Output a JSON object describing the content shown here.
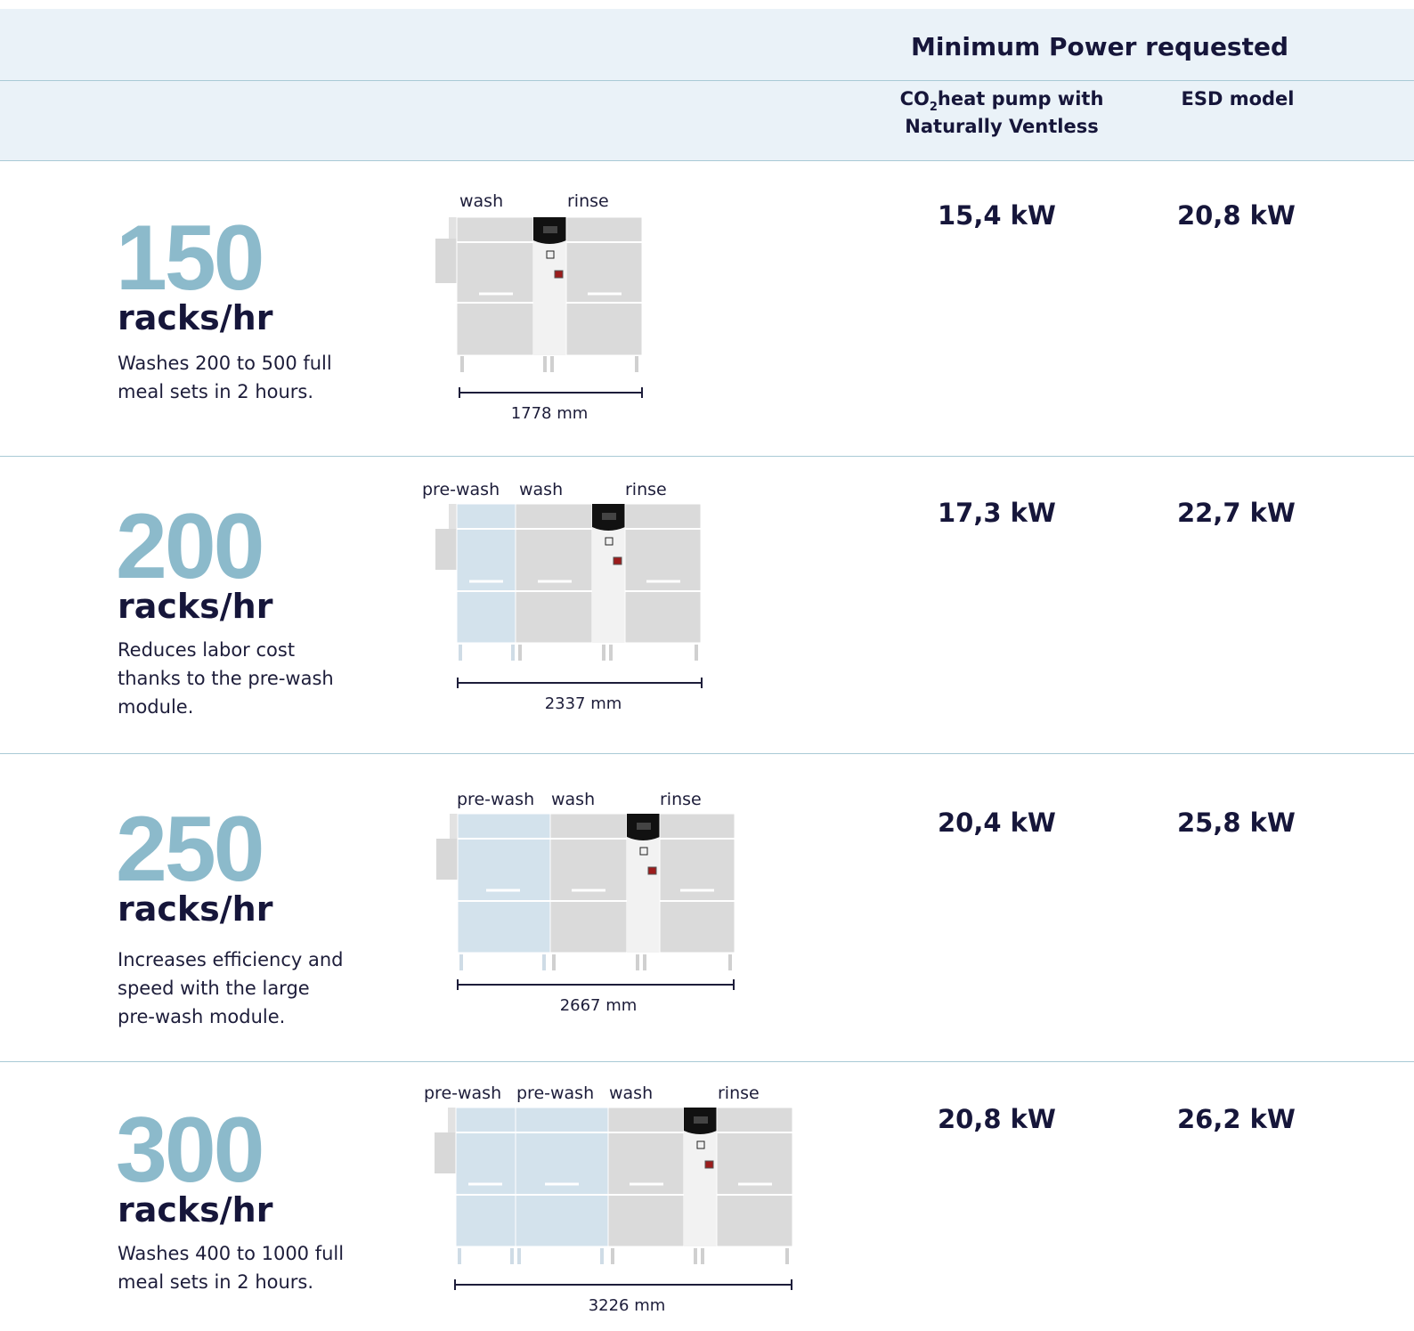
{
  "header": {
    "title": "Minimum Power requested",
    "col1_line1_pre": "CO",
    "col1_line1_sub": "2",
    "col1_line1_post": "heat pump with",
    "col1_line2": "Naturally Ventless",
    "col2": "ESD model"
  },
  "rows": [
    {
      "rate": "150",
      "unit": "racks/hr",
      "desc_lines": [
        "Washes 200 to 500 full",
        "meal sets in 2 hours."
      ],
      "modules": [
        "wash",
        "rinse"
      ],
      "length": "1778 mm",
      "power_co2": "15,4 kW",
      "power_esd": "20,8 kW"
    },
    {
      "rate": "200",
      "unit": "racks/hr",
      "desc_lines": [
        "Reduces labor cost",
        "thanks to the pre-wash",
        "module."
      ],
      "modules": [
        "pre-wash",
        "wash",
        "rinse"
      ],
      "length": "2337 mm",
      "power_co2": "17,3 kW",
      "power_esd": "22,7 kW"
    },
    {
      "rate": "250",
      "unit": "racks/hr",
      "desc_lines": [
        "Increases efficiency and",
        "speed with the large",
        "pre-wash module."
      ],
      "modules": [
        "pre-wash",
        "wash",
        "rinse"
      ],
      "length": "2667 mm",
      "power_co2": "20,4 kW",
      "power_esd": "25,8 kW"
    },
    {
      "rate": "300",
      "unit": "racks/hr",
      "desc_lines": [
        "Washes 400 to 1000 full",
        "meal sets in 2 hours."
      ],
      "modules": [
        "pre-wash",
        "pre-wash",
        "wash",
        "rinse"
      ],
      "length": "3226 mm",
      "power_co2": "20,8 kW",
      "power_esd": "26,2 kW"
    }
  ],
  "colors": {
    "accent": "#8cbacb",
    "text": "#16163a",
    "header_bg": "#eaf2f8",
    "divider": "#a9cad6",
    "prewash_module": "#d3e2ec",
    "module": "#dadada",
    "control_panel": "#111111"
  }
}
